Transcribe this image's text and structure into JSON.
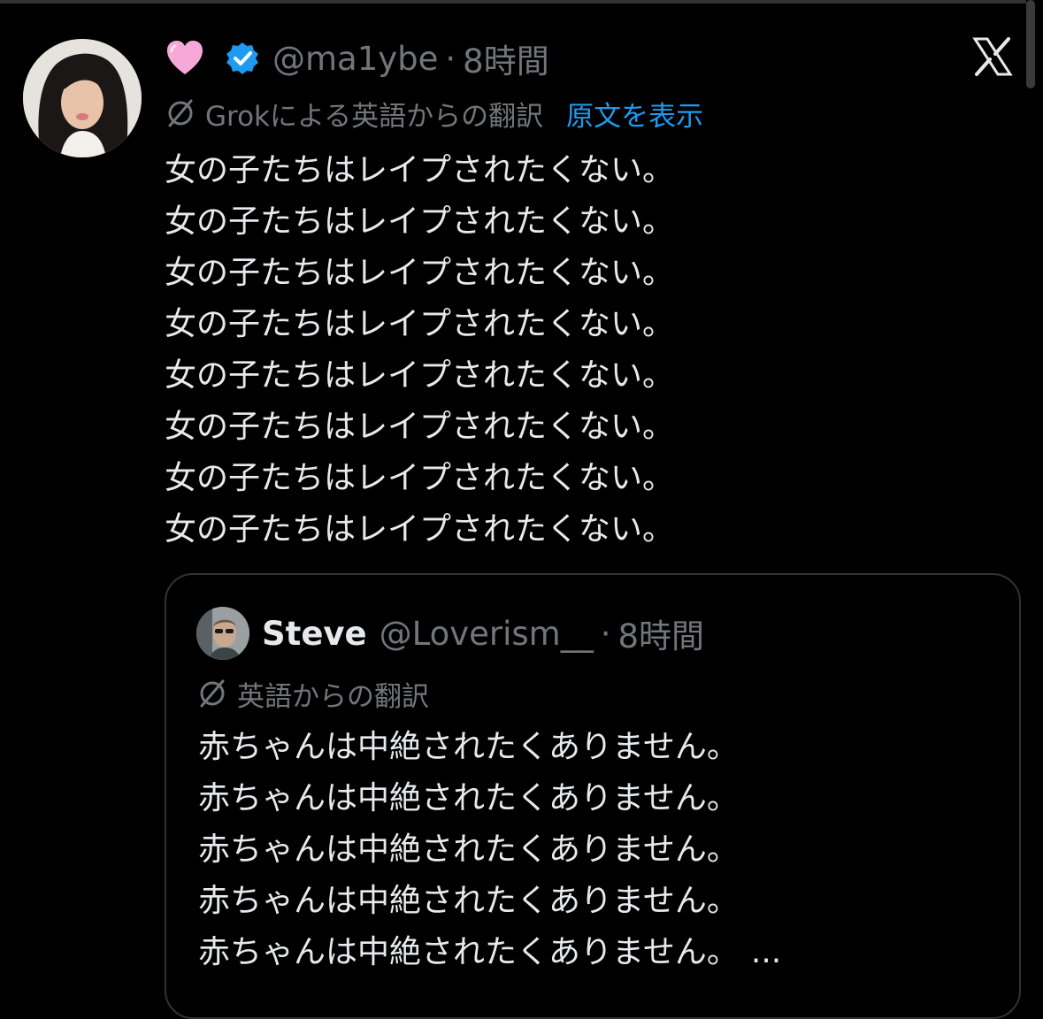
{
  "tweet": {
    "emoji": "💗",
    "handle": "@ma1ybe",
    "separator": "·",
    "time": "8時間",
    "translation_label": "Grokによる英語からの翻訳",
    "show_original": "原文を表示",
    "lines": [
      "女の子たちはレイプされたくない。",
      "女の子たちはレイプされたくない。",
      "女の子たちはレイプされたくない。",
      "女の子たちはレイプされたくない。",
      "女の子たちはレイプされたくない。",
      "女の子たちはレイプされたくない。",
      "女の子たちはレイプされたくない。",
      "女の子たちはレイプされたくない。"
    ]
  },
  "quote": {
    "name": "Steve",
    "handle": "@Loverism__",
    "separator": "·",
    "time": "8時間",
    "translation_label": "英語からの翻訳",
    "lines": [
      "赤ちゃんは中絶されたくありません。",
      "赤ちゃんは中絶されたくありません。",
      "赤ちゃんは中絶されたくありません。",
      "赤ちゃんは中絶されたくありません。",
      "赤ちゃんは中絶されたくありません。"
    ],
    "truncation": "..."
  },
  "icons": {
    "verified": "verified-badge-icon",
    "brand": "x-logo-icon",
    "translate": "grok-translate-icon"
  },
  "colors": {
    "background": "#000000",
    "text": "#e7e9ea",
    "muted": "#71767b",
    "link": "#1d9bf0",
    "verified": "#1d9bf0",
    "heart": "#f7a8d8"
  }
}
